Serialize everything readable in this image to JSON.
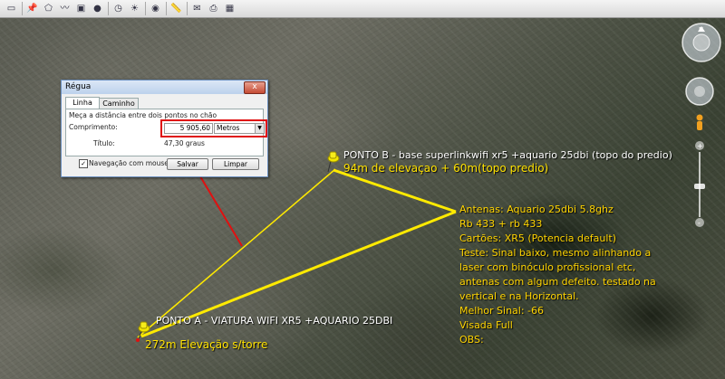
{
  "toolbar": {
    "icons": [
      "hide-sidebar-icon",
      "placemark-icon",
      "polygon-icon",
      "path-icon",
      "image-overlay-icon",
      "record-tour-icon",
      "historical-imagery-icon",
      "sunlight-icon",
      "planets-icon",
      "ruler-icon",
      "email-icon",
      "print-icon",
      "view-in-maps-icon"
    ]
  },
  "dialog": {
    "title": "Régua",
    "close_label": "x",
    "tabs": [
      "Linha",
      "Caminho"
    ],
    "instruction": "Meça a distância entre dois pontos no chão",
    "length_label": "Comprimento:",
    "length_value": "5 905,60",
    "unit_value": "Metros",
    "heading_label": "Título:",
    "heading_value": "47,30 graus",
    "mouse_nav_label": "Navegação com mouse",
    "mouse_nav_checked": true,
    "save_label": "Salvar",
    "clear_label": "Limpar"
  },
  "markers": {
    "point_b_title": "PONTO B - base superlinkwifi xr5 +aquario 25dbi (topo do predio)",
    "point_b_elevation": "94m de elevaçao +  60m(topo predio)",
    "point_a_title": "PONTO A - VIATURA WIFI XR5 +AQUARIO 25DBI",
    "point_a_elevation": "272m Elevação s/torre"
  },
  "notes": [
    "Antenas: Aquario 25dbi 5.8ghz",
    "Rb 433 + rb 433",
    "Cartões: XR5 (Potencia default)",
    "Teste: Sinal baixo, mesmo alinhando a laser com binóculo profissional etc, antenas com algum defeito. testado na vertical e na Horizontal.",
    "Melhor Sinal: -66",
    "Visada Full",
    "OBS:"
  ],
  "colors": {
    "highlight": "#e01010",
    "link_line": "#ffea00",
    "note_text": "#ffd400"
  }
}
